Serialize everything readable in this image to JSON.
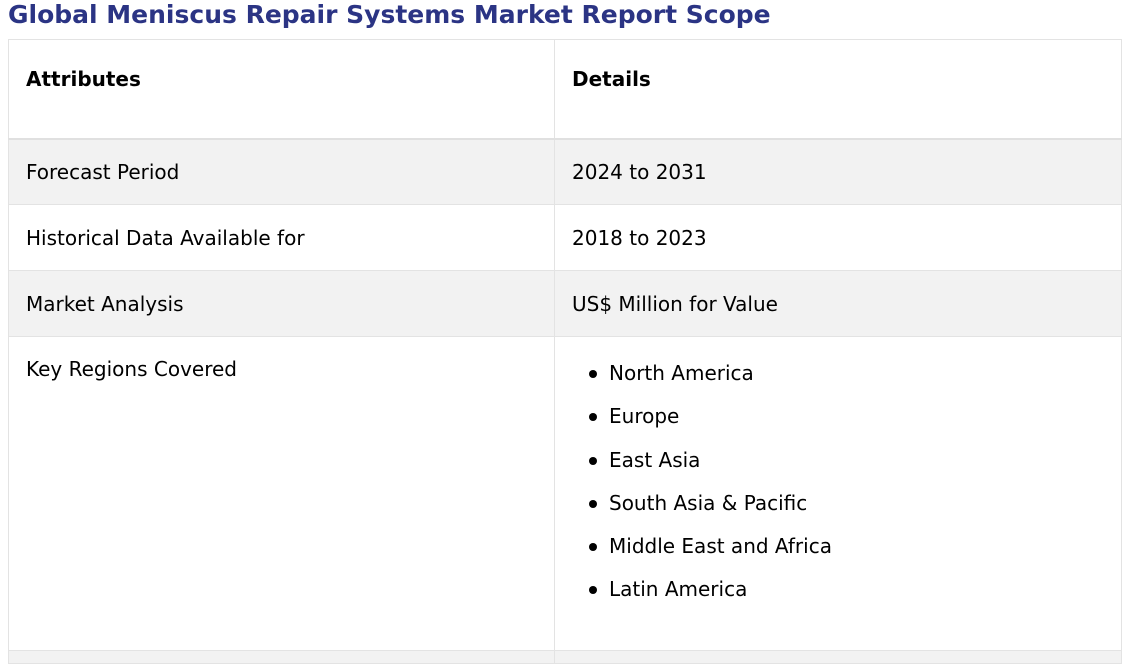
{
  "title": "Global Meniscus Repair Systems Market Report Scope",
  "table": {
    "headers": {
      "attributes": "Attributes",
      "details": "Details"
    },
    "rows": [
      {
        "attribute": "Forecast Period",
        "detail": "2024 to 2031"
      },
      {
        "attribute": "Historical Data Available for",
        "detail": "2018 to 2023"
      },
      {
        "attribute": "Market Analysis",
        "detail": "US$ Million for Value"
      }
    ],
    "regions": {
      "attribute": "Key Regions Covered",
      "items": [
        "North America",
        "Europe",
        "East Asia",
        "South Asia & Pacific",
        "Middle East and Africa",
        "Latin America"
      ]
    }
  },
  "colors": {
    "title": "#2b3484",
    "row_shade": "#f2f2f2",
    "border": "#e3e3e3"
  }
}
